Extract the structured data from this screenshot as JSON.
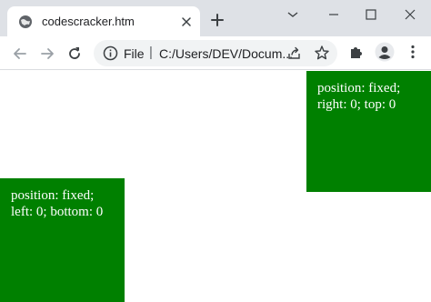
{
  "browser": {
    "tab": {
      "title": "codescracker.htm"
    },
    "address_bar": {
      "scheme_label": "File",
      "separator": "|",
      "url": "C:/Users/DEV/Docum..."
    }
  },
  "icons": {
    "favicon": "globe-icon",
    "tab_close": "close-icon",
    "new_tab": "plus-icon",
    "window_menu": "chevron-down-icon",
    "minimize": "minimize-icon",
    "maximize": "maximize-icon",
    "close": "close-icon",
    "back": "arrow-left-icon",
    "forward": "arrow-right-icon",
    "reload": "reload-icon",
    "site_info": "info-icon",
    "share": "share-icon",
    "bookmark": "star-icon",
    "extensions": "puzzle-icon",
    "profile": "avatar-icon",
    "menu": "kebab-menu-icon"
  },
  "colors": {
    "box_background": "#008000",
    "box_text": "#ffffff",
    "tabstrip": "#dee1e6",
    "omnibox": "#f1f3f4"
  },
  "page": {
    "fixed_right_box": {
      "line1": "position: fixed;",
      "line2": "right: 0; top: 0"
    },
    "fixed_left_box": {
      "line1": "position: fixed;",
      "line2": "left: 0; bottom: 0"
    }
  }
}
